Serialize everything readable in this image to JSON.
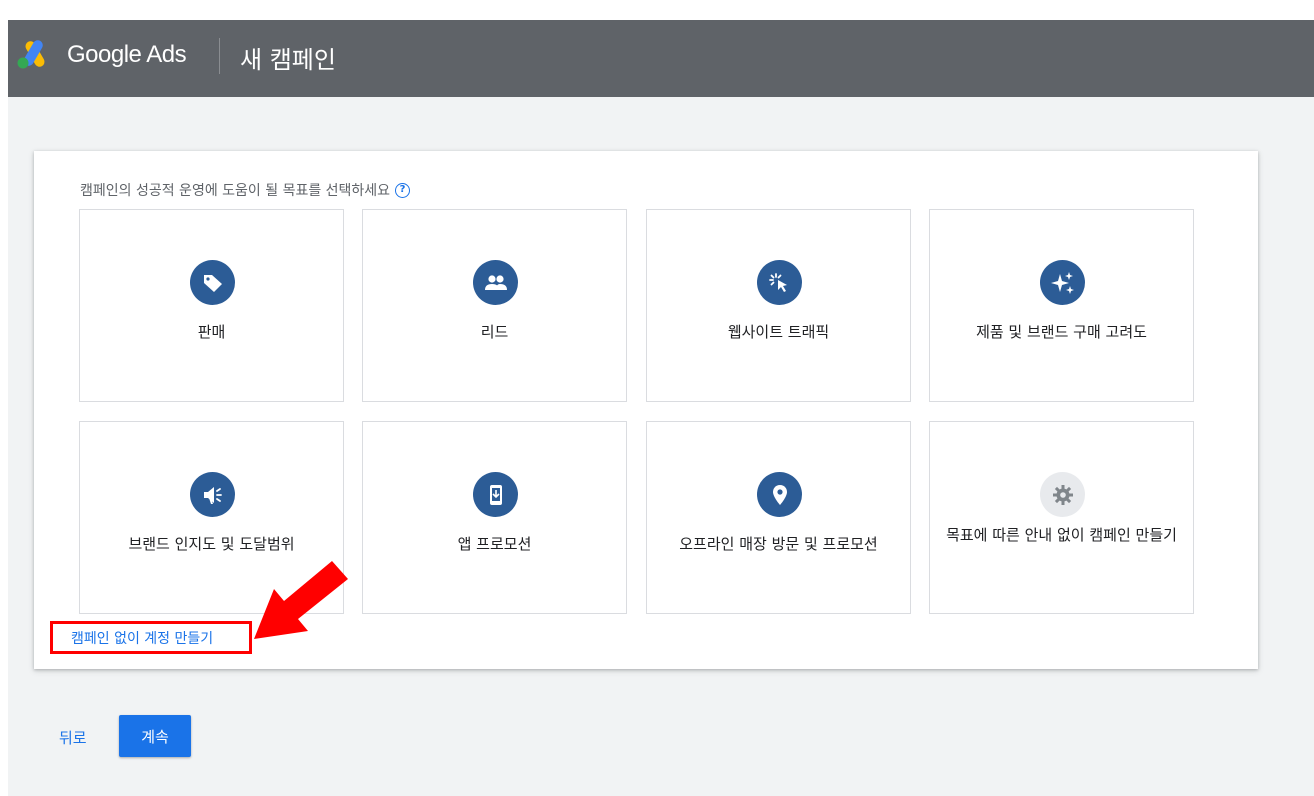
{
  "header": {
    "brand": "Google Ads",
    "title": "새 캠페인"
  },
  "goals": {
    "prompt": "캠페인의 성공적 운영에 도움이 될 목표를 선택하세요",
    "help_glyph": "?",
    "tiles": [
      {
        "label": "판매",
        "icon": "tag-icon"
      },
      {
        "label": "리드",
        "icon": "people-icon"
      },
      {
        "label": "웹사이트 트래픽",
        "icon": "cursor-click-icon"
      },
      {
        "label": "제품 및 브랜드 구매 고려도",
        "icon": "sparkle-icon"
      },
      {
        "label": "브랜드 인지도 및 도달범위",
        "icon": "megaphone-icon"
      },
      {
        "label": "앱 프로모션",
        "icon": "phone-download-icon"
      },
      {
        "label": "오프라인 매장 방문 및 프로모션",
        "icon": "location-pin-icon"
      },
      {
        "label": "목표에 따른 안내 없이 캠페인 만들기",
        "icon": "gear-icon"
      }
    ],
    "no_campaign_link": "캠페인 없이 계정 만들기"
  },
  "footer": {
    "back_label": "뒤로",
    "continue_label": "계속"
  },
  "colors": {
    "header_bg": "#5f6368",
    "icon_circle": "#2c5c96",
    "primary_blue": "#1a73e8",
    "highlight_red": "#ff0000"
  }
}
